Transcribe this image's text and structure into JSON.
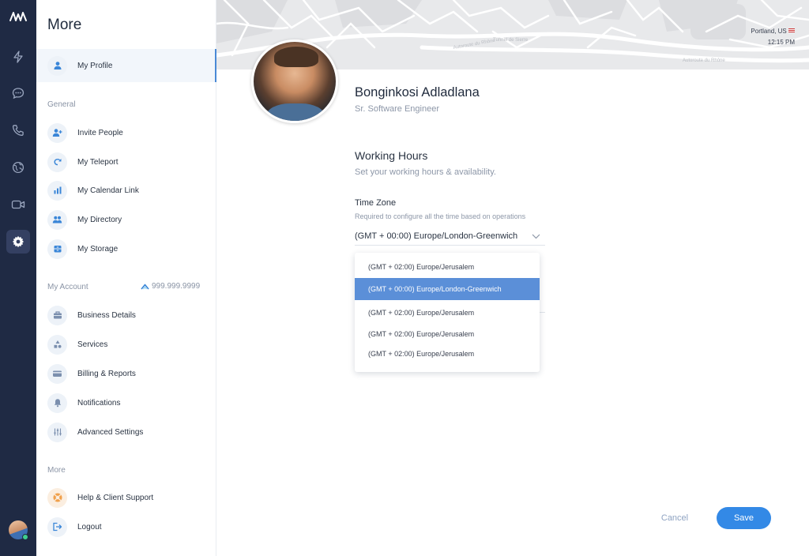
{
  "colors": {
    "rail": "#1f2a44",
    "accent": "#3389e6",
    "selected_option": "#5b8fd8"
  },
  "rail": {
    "icons": [
      "logo-icon",
      "lightning-icon",
      "chat-icon",
      "phone-icon",
      "globe-icon",
      "video-icon",
      "gear-icon"
    ],
    "active": "gear-icon"
  },
  "sidebar": {
    "title": "More",
    "profile": {
      "label": "My Profile",
      "icon": "person-icon"
    },
    "general": {
      "heading": "General",
      "items": [
        {
          "label": "Invite People",
          "icon": "person-add-icon"
        },
        {
          "label": "My Teleport",
          "icon": "teleport-icon"
        },
        {
          "label": "My Calendar Link",
          "icon": "chart-icon"
        },
        {
          "label": "My Directory",
          "icon": "people-icon"
        },
        {
          "label": "My Storage",
          "icon": "storage-icon"
        }
      ]
    },
    "account": {
      "heading": "My Account",
      "phone": "999.999.9999",
      "items": [
        {
          "label": "Business Details",
          "icon": "briefcase-icon"
        },
        {
          "label": "Services",
          "icon": "shapes-icon"
        },
        {
          "label": "Billing & Reports",
          "icon": "card-icon"
        },
        {
          "label": "Notifications",
          "icon": "bell-icon"
        },
        {
          "label": "Advanced Settings",
          "icon": "sliders-icon"
        }
      ]
    },
    "more": {
      "heading": "More",
      "items": [
        {
          "label": "Help & Client Support",
          "icon": "lifebuoy-icon"
        },
        {
          "label": "Logout",
          "icon": "logout-icon"
        }
      ]
    }
  },
  "header": {
    "location": "Portland, US",
    "time": "12:15 PM"
  },
  "profile": {
    "name": "Bonginkosi Adladlana",
    "role": "Sr. Software Engineer"
  },
  "working_hours": {
    "title": "Working Hours",
    "subtitle": "Set your working hours & availability.",
    "timezone_label": "Time Zone",
    "timezone_help": "Required to configure all the time based on operations",
    "timezone_value": "(GMT + 00:00) Europe/London-Greenwich",
    "options": [
      "(GMT + 02:00) Europe/Jerusalem",
      "(GMT + 00:00) Europe/London-Greenwich",
      "(GMT + 02:00) Europe/Jerusalem",
      "(GMT + 02:00) Europe/Jerusalem",
      "(GMT + 02:00) Europe/Jerusalem"
    ],
    "selected_index": 1
  },
  "actions": {
    "cancel": "Cancel",
    "save": "Save"
  }
}
